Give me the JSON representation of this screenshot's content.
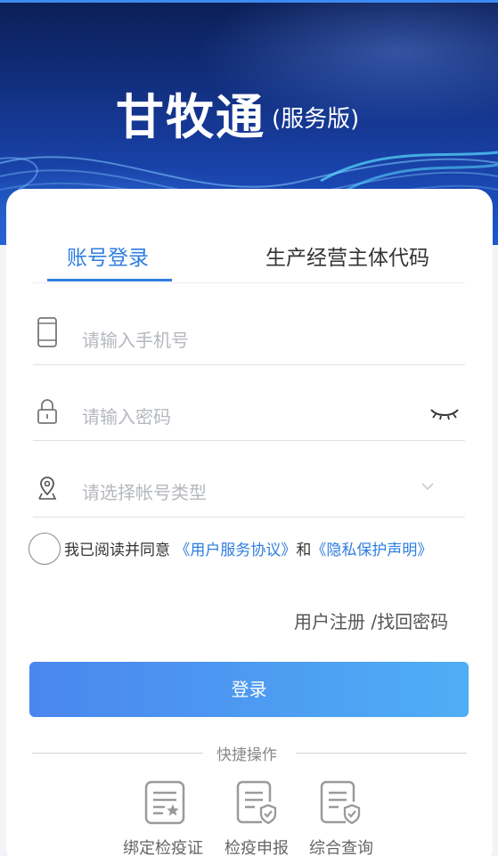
{
  "header": {
    "title": "甘牧通",
    "subtitle": "(服务版)"
  },
  "tabs": [
    {
      "label": "账号登录",
      "active": true
    },
    {
      "label": "生产经营主体代码",
      "active": false
    }
  ],
  "form": {
    "phone_placeholder": "请输入手机号",
    "password_placeholder": "请输入密码",
    "account_type_placeholder": "请选择帐号类型"
  },
  "agreement": {
    "prefix": "我已阅读并同意",
    "service_link": "《用户服务协议》",
    "and": "和",
    "privacy_link": "《隐私保护声明》"
  },
  "links": {
    "register": "用户注册",
    "recover": "/找回密码"
  },
  "login_button": "登录",
  "quick": {
    "title": "快捷操作",
    "items": [
      {
        "label": "绑定检疫证",
        "icon": "certificate-star-icon"
      },
      {
        "label": "检疫申报",
        "icon": "document-shield-icon"
      },
      {
        "label": "综合查询",
        "icon": "document-shield-icon"
      }
    ]
  },
  "colors": {
    "accent": "#2e7de0",
    "button_start": "#4a86ee",
    "button_end": "#4faef5",
    "hero_dark": "#0b1f57"
  }
}
